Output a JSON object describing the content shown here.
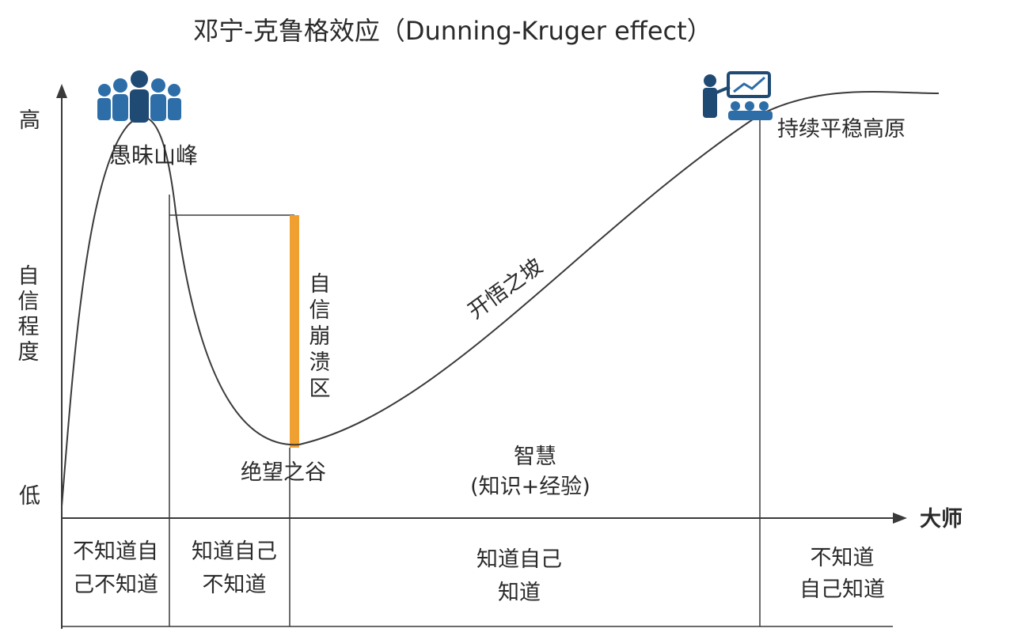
{
  "title": "邓宁-克鲁格效应（Dunning-Kruger effect）",
  "y_axis": {
    "label": "自信程度",
    "high": "高",
    "low": "低"
  },
  "x_axis": {
    "end_label": "大师"
  },
  "curve_labels": {
    "peak": "愚昧山峰",
    "valley": "绝望之谷",
    "slope": "开悟之坡",
    "plateau": "持续平稳高原",
    "collapse_zone": "自信崩溃区"
  },
  "wisdom": {
    "line1": "智慧",
    "line2": "(知识+经验)"
  },
  "stages": [
    {
      "line1": "不知道自",
      "line2": "己不知道"
    },
    {
      "line1": "知道自己",
      "line2": "不知道"
    },
    {
      "line1": "知道自己",
      "line2": "知道"
    },
    {
      "line1": "不知道",
      "line2": "自己知道"
    }
  ],
  "colors": {
    "line": "#3a3a3a",
    "collapse_bar": "#f0a030",
    "icon": "#2d6ea8",
    "icon_dark": "#1f4a73"
  },
  "icons": {
    "crowd": "people-group-icon",
    "presenter": "presenter-icon"
  }
}
